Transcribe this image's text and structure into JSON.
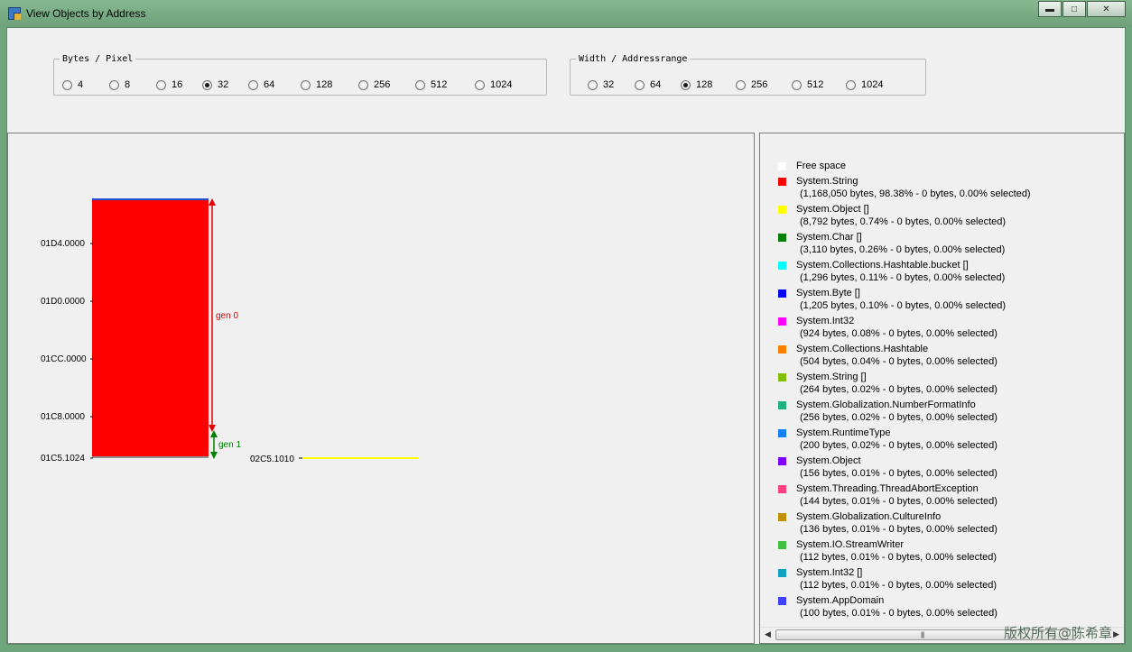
{
  "window": {
    "title": "View Objects by Address",
    "controls": [
      "minimize-icon",
      "maximize-icon",
      "close-icon"
    ]
  },
  "bytes_per_pixel": {
    "legend": "Bytes / Pixel",
    "options": [
      "4",
      "8",
      "16",
      "32",
      "64",
      "128",
      "256",
      "512",
      "1024"
    ],
    "selected": "32"
  },
  "width_addressrange": {
    "legend": "Width / Addressrange",
    "options": [
      "32",
      "64",
      "128",
      "256",
      "512",
      "1024"
    ],
    "selected": "128"
  },
  "address_plot": {
    "axis_labels": [
      "01D4.0000",
      "01D0.0000",
      "01CC.0000",
      "01C8.0000",
      "01C5.1024"
    ],
    "second_address": "02C5.1010",
    "gen0_label": "gen 0",
    "gen1_label": "gen 1",
    "colors": {
      "block": "#ff0000",
      "gen0": "#e00000",
      "gen1": "#008000",
      "strip": "#ffff00"
    }
  },
  "legend": {
    "free_space": {
      "name": "Free space",
      "color": "#ffffff"
    },
    "items": [
      {
        "name": "System.String",
        "detail": "(1,168,050 bytes, 98.38% - 0 bytes, 0.00% selected)",
        "color": "#ff0000"
      },
      {
        "name": "System.Object []",
        "detail": "(8,792 bytes, 0.74% - 0 bytes, 0.00% selected)",
        "color": "#ffff00"
      },
      {
        "name": "System.Char []",
        "detail": "(3,110 bytes, 0.26% - 0 bytes, 0.00% selected)",
        "color": "#008000"
      },
      {
        "name": "System.Collections.Hashtable.bucket []",
        "detail": "(1,296 bytes, 0.11% - 0 bytes, 0.00% selected)",
        "color": "#00ffff"
      },
      {
        "name": "System.Byte []",
        "detail": "(1,205 bytes, 0.10% - 0 bytes, 0.00% selected)",
        "color": "#0000ff"
      },
      {
        "name": "System.Int32",
        "detail": "(924 bytes, 0.08% - 0 bytes, 0.00% selected)",
        "color": "#ff00ff"
      },
      {
        "name": "System.Collections.Hashtable",
        "detail": "(504 bytes, 0.04% - 0 bytes, 0.00% selected)",
        "color": "#ff8000"
      },
      {
        "name": "System.String []",
        "detail": "(264 bytes, 0.02% - 0 bytes, 0.00% selected)",
        "color": "#80c000"
      },
      {
        "name": "System.Globalization.NumberFormatInfo",
        "detail": "(256 bytes, 0.02% - 0 bytes, 0.00% selected)",
        "color": "#20b080"
      },
      {
        "name": "System.RuntimeType",
        "detail": "(200 bytes, 0.02% - 0 bytes, 0.00% selected)",
        "color": "#1080ff"
      },
      {
        "name": "System.Object",
        "detail": "(156 bytes, 0.01% - 0 bytes, 0.00% selected)",
        "color": "#8000ff"
      },
      {
        "name": "System.Threading.ThreadAbortException",
        "detail": "(144 bytes, 0.01% - 0 bytes, 0.00% selected)",
        "color": "#ff4080"
      },
      {
        "name": "System.Globalization.CultureInfo",
        "detail": "(136 bytes, 0.01% - 0 bytes, 0.00% selected)",
        "color": "#c09000"
      },
      {
        "name": "System.IO.StreamWriter",
        "detail": "(112 bytes, 0.01% - 0 bytes, 0.00% selected)",
        "color": "#40c040"
      },
      {
        "name": "System.Int32 []",
        "detail": "(112 bytes, 0.01% - 0 bytes, 0.00% selected)",
        "color": "#10a0c0"
      },
      {
        "name": "System.AppDomain",
        "detail": "(100 bytes, 0.01% - 0 bytes, 0.00% selected)",
        "color": "#4040ff"
      }
    ]
  },
  "watermark": "版权所有@陈希章"
}
